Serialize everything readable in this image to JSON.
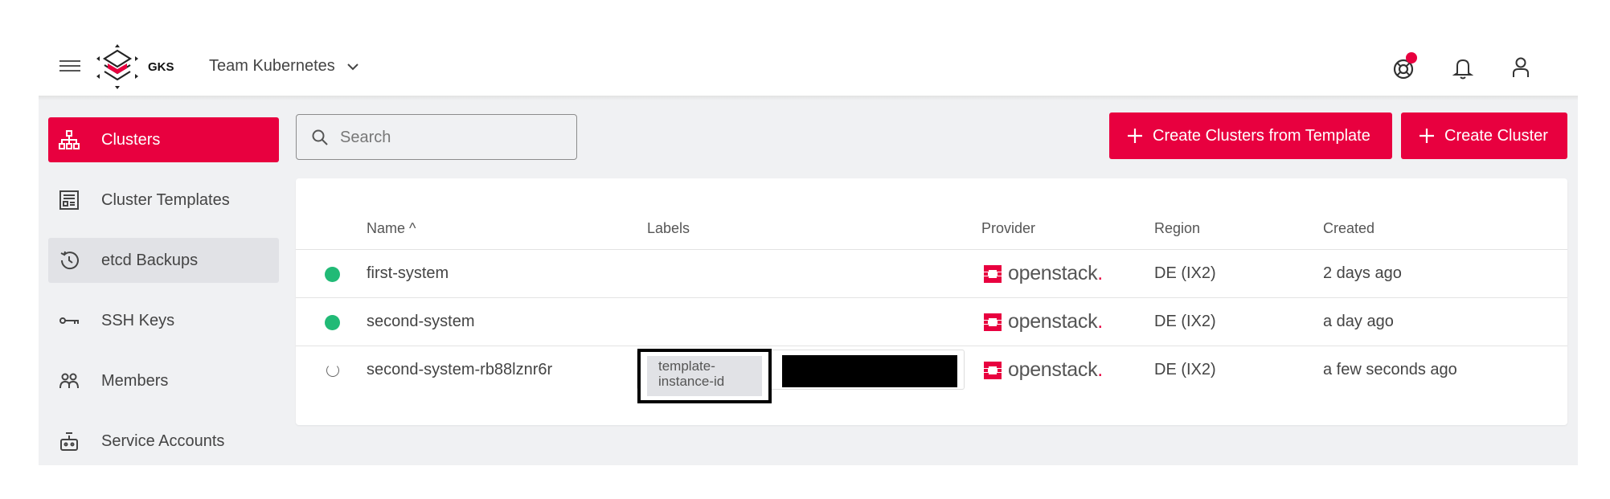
{
  "header": {
    "brand": "GKS",
    "project": "Team Kubernetes",
    "icons": [
      "menu-icon",
      "help-icon",
      "bell-icon",
      "user-icon"
    ]
  },
  "sidebar": {
    "items": [
      {
        "label": "Clusters",
        "icon": "clusters-icon"
      },
      {
        "label": "Cluster Templates",
        "icon": "template-icon"
      },
      {
        "label": "etcd Backups",
        "icon": "history-icon"
      },
      {
        "label": "SSH Keys",
        "icon": "key-icon"
      },
      {
        "label": "Members",
        "icon": "members-icon"
      },
      {
        "label": "Service Accounts",
        "icon": "robot-icon"
      }
    ]
  },
  "search": {
    "placeholder": "Search"
  },
  "toolbar": {
    "create_from_template": "Create Clusters from Template",
    "create_cluster": "Create Cluster"
  },
  "table": {
    "columns": [
      "Name ^",
      "Labels",
      "Provider",
      "Region",
      "Created"
    ],
    "rows": [
      {
        "status": "running",
        "name": "first-system",
        "labels": [],
        "provider": "openstack",
        "region": "DE (IX2)",
        "created": "2 days ago"
      },
      {
        "status": "running",
        "name": "second-system",
        "labels": [],
        "provider": "openstack",
        "region": "DE (IX2)",
        "created": "a day ago"
      },
      {
        "status": "provisioning",
        "name": "second-system-rb88lznr6r",
        "labels": [
          "template-instance-id"
        ],
        "provider": "openstack",
        "region": "DE (IX2)",
        "created": "a few seconds ago"
      }
    ]
  },
  "provider_dot": ".",
  "colors": {
    "accent": "#e8003f",
    "running": "#21ba76",
    "background": "#f0f1f3"
  }
}
